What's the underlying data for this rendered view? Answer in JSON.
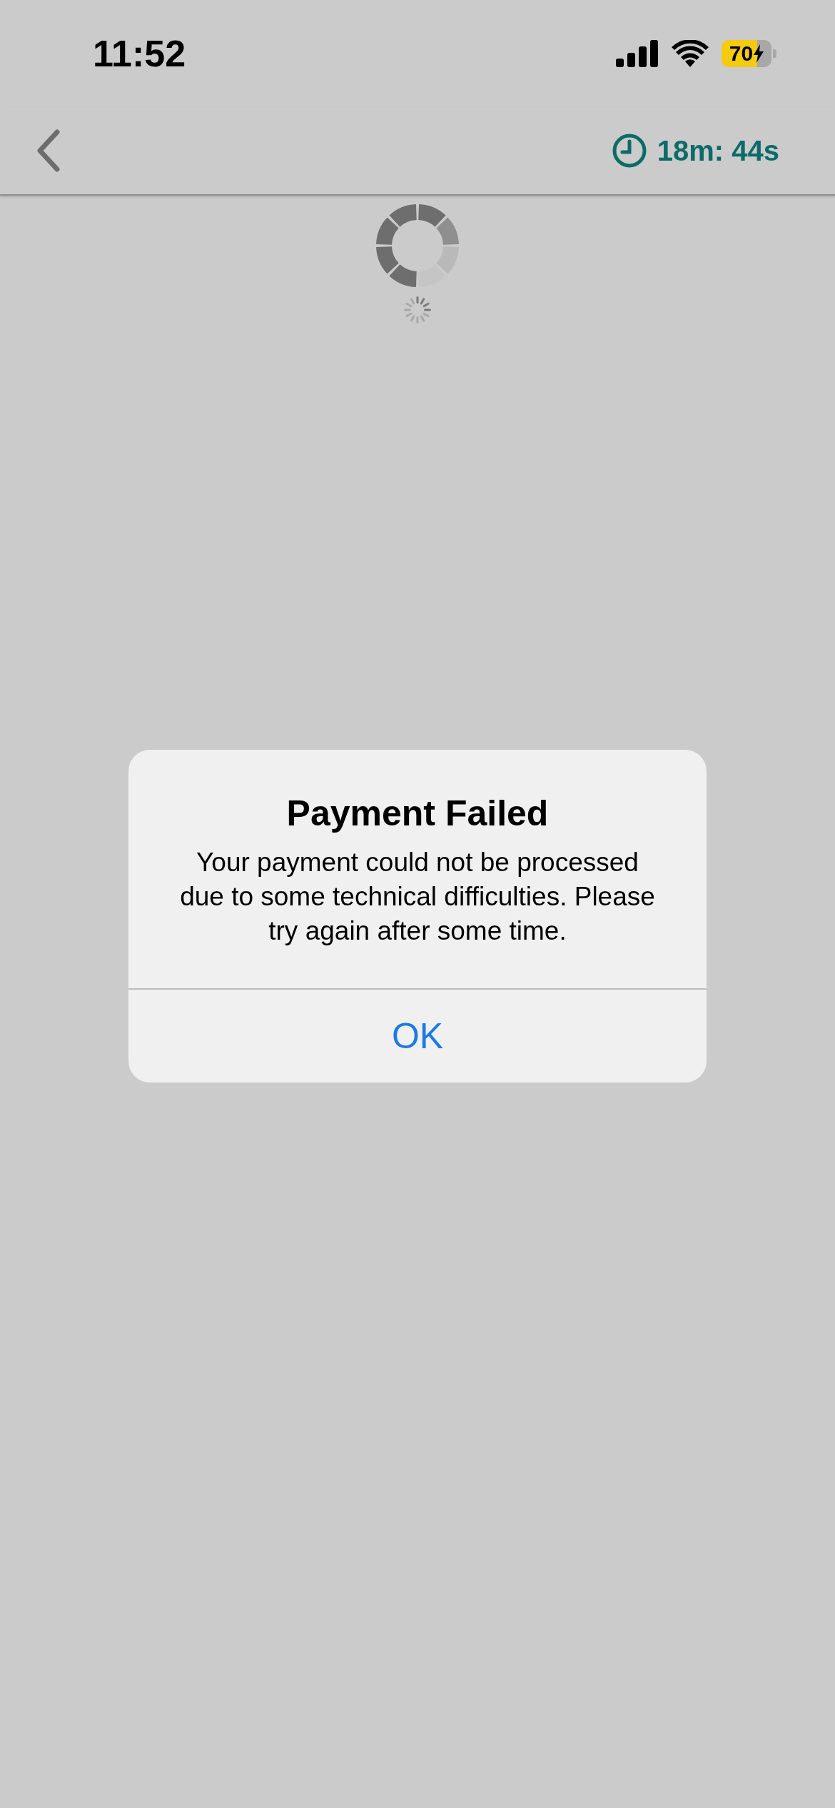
{
  "status_bar": {
    "time": "11:52",
    "battery": {
      "text": "70",
      "charging": true
    }
  },
  "header": {
    "timer": "18m: 44s"
  },
  "alert": {
    "title": "Payment Failed",
    "message": "Your payment could not be processed due to some technical difficulties. Please try again after some time.",
    "buttons": [
      "OK"
    ]
  }
}
